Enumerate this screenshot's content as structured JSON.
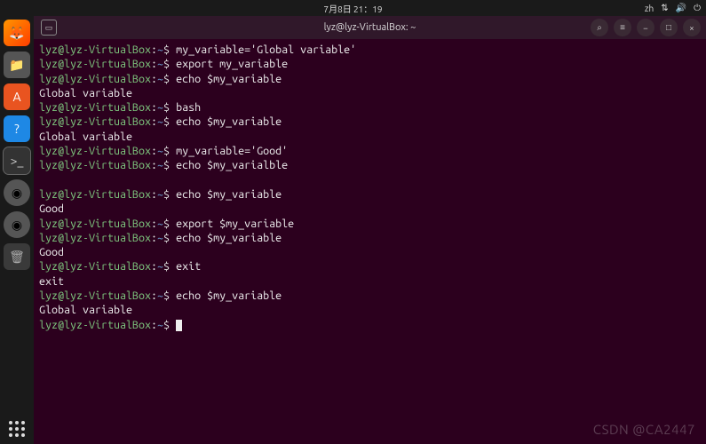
{
  "topbar": {
    "datetime": "7月8日 21：19",
    "lang": "zh",
    "icons": [
      "net",
      "vol",
      "pow"
    ]
  },
  "launcher": {
    "icons": [
      "firefox",
      "files",
      "software",
      "help",
      "terminal",
      "disc",
      "disc2",
      "trash"
    ]
  },
  "window": {
    "title": "lyz@lyz-VirtualBox: ~",
    "controls": {
      "search": "⌕",
      "menu": "≡",
      "min": "−",
      "max": "□",
      "close": "×"
    },
    "tab_icon": "▭"
  },
  "prompt": {
    "user": "lyz@lyz-VirtualBox",
    "sep": ":",
    "path": "~",
    "sigil": "$"
  },
  "lines": [
    {
      "type": "cmd",
      "text": "my_variable='Global variable'"
    },
    {
      "type": "cmd",
      "text": "export my_variable"
    },
    {
      "type": "cmd",
      "text": "echo $my_variable"
    },
    {
      "type": "out",
      "text": "Global variable"
    },
    {
      "type": "cmd",
      "text": "bash"
    },
    {
      "type": "cmd",
      "text": "echo $my_variable"
    },
    {
      "type": "out",
      "text": "Global variable"
    },
    {
      "type": "cmd",
      "text": "my_variable='Good'"
    },
    {
      "type": "cmd",
      "text": "echo $my_varialble"
    },
    {
      "type": "out",
      "text": ""
    },
    {
      "type": "cmd",
      "text": "echo $my_variable"
    },
    {
      "type": "out",
      "text": "Good"
    },
    {
      "type": "cmd",
      "text": "export $my_variable"
    },
    {
      "type": "cmd",
      "text": "echo $my_variable"
    },
    {
      "type": "out",
      "text": "Good"
    },
    {
      "type": "cmd",
      "text": "exit"
    },
    {
      "type": "out",
      "text": "exit"
    },
    {
      "type": "cmd",
      "text": "echo $my_variable"
    },
    {
      "type": "out",
      "text": "Global variable"
    },
    {
      "type": "prompt",
      "text": ""
    }
  ],
  "watermark": "CSDN @CA2447"
}
